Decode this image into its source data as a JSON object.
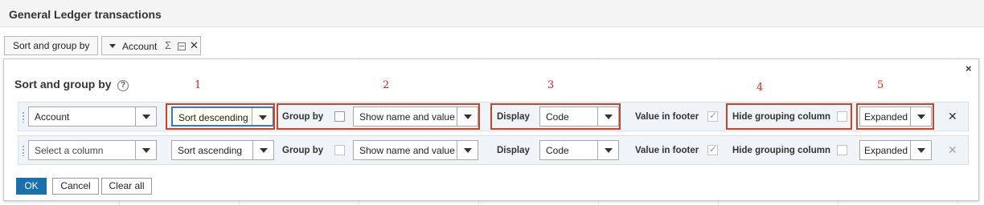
{
  "page": {
    "title": "General Ledger transactions"
  },
  "toolbar": {
    "sort_chip_label": "Sort and group by",
    "account_chip_label": "Account",
    "sigma_glyph": "Σ",
    "close_glyph": "✕"
  },
  "dialog": {
    "title": "Sort and group by",
    "help_glyph": "?",
    "close_glyph": "×",
    "callouts": [
      "1",
      "2",
      "3",
      "4",
      "5"
    ],
    "rows": [
      {
        "column": "Account",
        "sort": "Sort descending",
        "group_by_label": "Group by",
        "group_by_checked": false,
        "group_display": "Show name and value",
        "display_label": "Display",
        "display_value": "Code",
        "value_in_footer_label": "Value in footer",
        "value_in_footer_checked": true,
        "hide_grouping_label": "Hide grouping column",
        "hide_grouping_checked": false,
        "expand_state": "Expanded",
        "remove_glyph": "✕"
      },
      {
        "column": "Select a column",
        "sort": "Sort ascending",
        "group_by_label": "Group by",
        "group_by_checked": false,
        "group_display": "Show name and value",
        "display_label": "Display",
        "display_value": "Code",
        "value_in_footer_label": "Value in footer",
        "value_in_footer_checked": true,
        "hide_grouping_label": "Hide grouping column",
        "hide_grouping_checked": false,
        "expand_state": "Expanded",
        "remove_glyph": "✕"
      }
    ],
    "buttons": {
      "ok": "OK",
      "cancel": "Cancel",
      "clear_all": "Clear all"
    }
  },
  "colors": {
    "highlight": "#c8442a",
    "callout": "#e02020",
    "primary": "#1a6fad",
    "row_bg": "#eef4f7"
  }
}
